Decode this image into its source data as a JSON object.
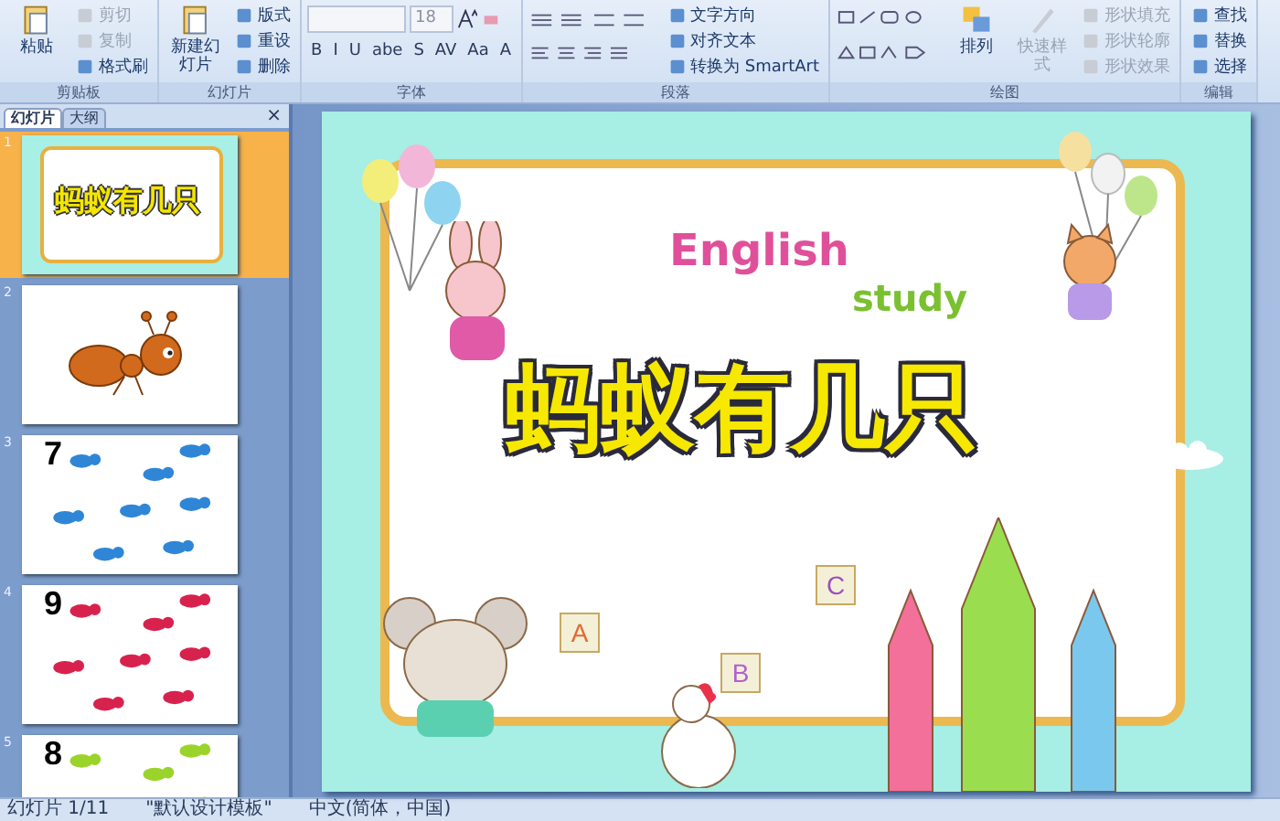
{
  "ribbon": {
    "groups": [
      {
        "kind": "clipboard",
        "label": "剪贴板",
        "large": {
          "label": "粘贴",
          "disabled": false
        },
        "items": [
          {
            "label": "剪切",
            "disabled": true
          },
          {
            "label": "复制",
            "disabled": true
          },
          {
            "label": "格式刷",
            "disabled": false
          }
        ]
      },
      {
        "kind": "slides",
        "label": "幻灯片",
        "large": {
          "label": "新建幻灯片",
          "disabled": false
        },
        "items": [
          {
            "label": "版式",
            "disabled": false
          },
          {
            "label": "重设",
            "disabled": false
          },
          {
            "label": "删除",
            "disabled": false
          }
        ]
      },
      {
        "kind": "font",
        "label": "字体",
        "size": "18",
        "tools": [
          "B",
          "I",
          "U",
          "abe",
          "S",
          "AV",
          "Aa",
          "A"
        ]
      },
      {
        "kind": "paragraph",
        "label": "段落",
        "items": [
          {
            "label": "文字方向",
            "disabled": false
          },
          {
            "label": "对齐文本",
            "disabled": false
          },
          {
            "label": "转换为 SmartArt",
            "disabled": false
          }
        ]
      },
      {
        "kind": "drawing",
        "label": "绘图",
        "large": {
          "label": "排列",
          "disabled": false
        },
        "large2": {
          "label": "快速样式",
          "disabled": true
        },
        "items": [
          {
            "label": "形状填充",
            "disabled": true
          },
          {
            "label": "形状轮廓",
            "disabled": true
          },
          {
            "label": "形状效果",
            "disabled": true
          }
        ]
      },
      {
        "kind": "editing",
        "label": "编辑",
        "items": [
          {
            "label": "查找",
            "disabled": false
          },
          {
            "label": "替换",
            "disabled": false
          },
          {
            "label": "选择",
            "disabled": false
          }
        ]
      }
    ]
  },
  "panel": {
    "tabs": [
      {
        "label": "幻灯片",
        "selected": true
      },
      {
        "label": "大纲",
        "selected": false
      }
    ],
    "close": "×"
  },
  "slides": [
    {
      "number": "1",
      "kind": "title",
      "selected": true,
      "text": "蚂蚁有几只"
    },
    {
      "number": "2",
      "kind": "ant",
      "selected": false
    },
    {
      "number": "3",
      "kind": "count",
      "selected": false,
      "text": "7",
      "color": "#2f86d6"
    },
    {
      "number": "4",
      "kind": "count",
      "selected": false,
      "text": "9",
      "color": "#d8224e"
    },
    {
      "number": "5",
      "kind": "count",
      "selected": false,
      "text": "8",
      "color": "#9ad42a"
    }
  ],
  "slide": {
    "line1": "English",
    "line2": "study",
    "title": "蚂蚁有几只",
    "blocks": [
      "A",
      "B",
      "C"
    ]
  },
  "status_bar": [
    "幻灯片 1/11",
    "\"默认设计模板\"",
    "中文(简体，中国)"
  ]
}
